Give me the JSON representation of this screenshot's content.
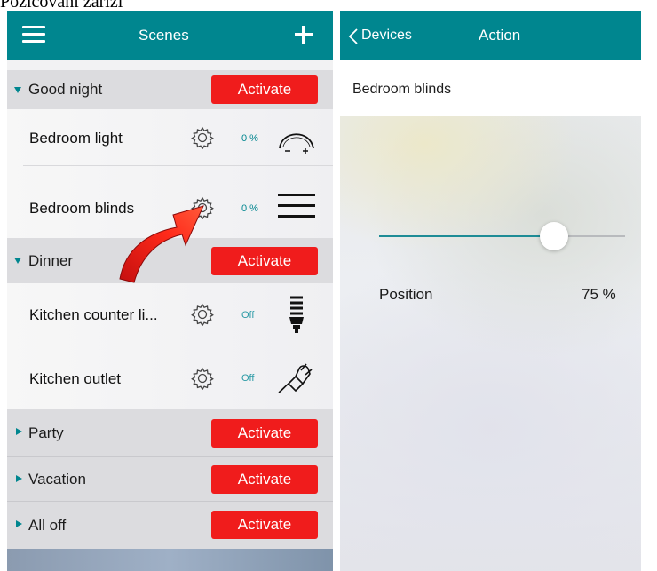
{
  "caption": "Pozicování zařízí",
  "colors": {
    "navbar": "#00868f",
    "activate": "#f01c1c",
    "accent": "#00868f"
  },
  "left": {
    "nav": {
      "title": "Scenes",
      "menu_icon": "menu-icon",
      "add_icon": "plus-icon"
    },
    "activate_label": "Activate",
    "scenes": [
      {
        "name": "Good night",
        "expanded": true,
        "devices": [
          {
            "name": "Bedroom light",
            "value": "0 %",
            "icon": "dimmer-icon"
          },
          {
            "name": "Bedroom blinds",
            "value": "0 %",
            "icon": "blinds-icon"
          }
        ]
      },
      {
        "name": "Dinner",
        "expanded": true,
        "devices": [
          {
            "name": "Kitchen counter li...",
            "value": "Off",
            "icon": "bulb-icon"
          },
          {
            "name": "Kitchen outlet",
            "value": "Off",
            "icon": "plug-icon"
          }
        ]
      },
      {
        "name": "Party",
        "expanded": false
      },
      {
        "name": "Vacation",
        "expanded": false
      },
      {
        "name": "All off",
        "expanded": false
      }
    ]
  },
  "right": {
    "nav": {
      "back_label": "Devices",
      "title": "Action"
    },
    "device_title": "Bedroom blinds",
    "position": {
      "label": "Position",
      "value": "75 %",
      "level": 0.71
    }
  }
}
